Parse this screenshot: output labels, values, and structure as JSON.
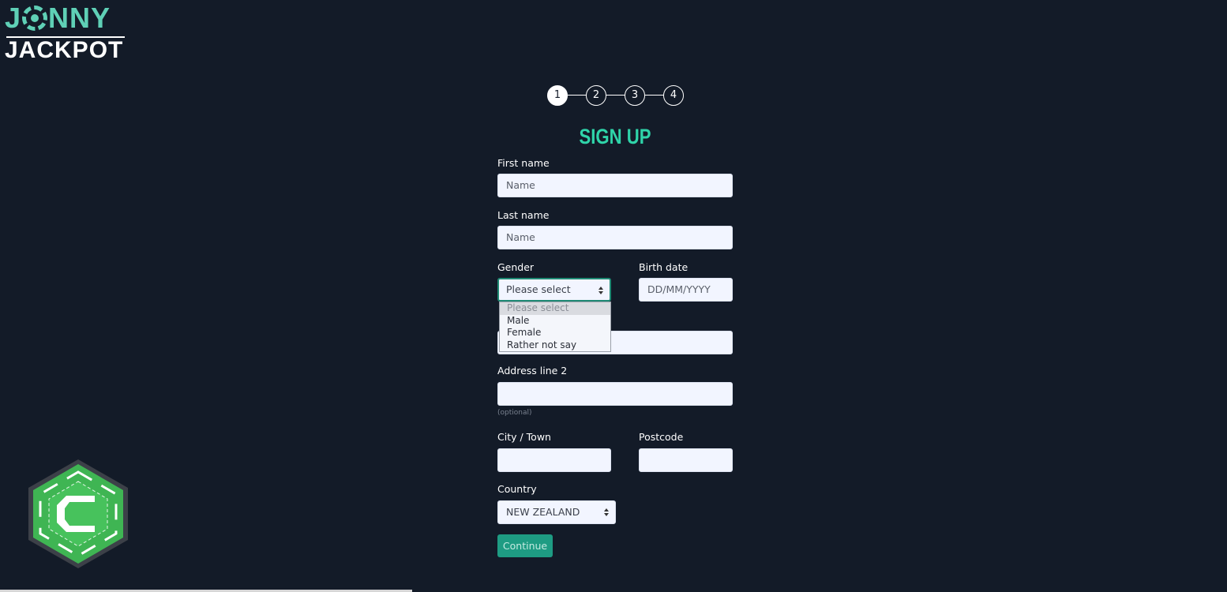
{
  "brand": {
    "logo_top": "JONNY",
    "logo_bottom": "JACKPOT"
  },
  "stepper": {
    "steps": [
      "1",
      "2",
      "3",
      "4"
    ],
    "active": 1
  },
  "title": "SIGN UP",
  "form": {
    "first_name": {
      "label": "First name",
      "placeholder": "Name",
      "value": ""
    },
    "last_name": {
      "label": "Last name",
      "placeholder": "Name",
      "value": ""
    },
    "gender": {
      "label": "Gender",
      "selected": "Please select",
      "options": [
        "Please select",
        "Male",
        "Female",
        "Rather not say"
      ]
    },
    "birth_date": {
      "label": "Birth date",
      "placeholder": "DD/MM/YYYY",
      "value": ""
    },
    "address_line_1": {
      "value": ""
    },
    "address_line_2": {
      "label": "Address line 2",
      "hint": "(optional)",
      "value": ""
    },
    "city": {
      "label": "City / Town",
      "value": ""
    },
    "postcode": {
      "label": "Postcode",
      "value": ""
    },
    "country": {
      "label": "Country",
      "selected": "NEW ZEALAND"
    },
    "continue_label": "Continue"
  },
  "colors": {
    "background": "#131b28",
    "accent": "#2fd4a9",
    "button": "#1e9c83",
    "logo_teal": "#5fd0b6",
    "badge_green": "#3fb553"
  },
  "icons": {
    "badge": "casino-chip-c-icon"
  }
}
